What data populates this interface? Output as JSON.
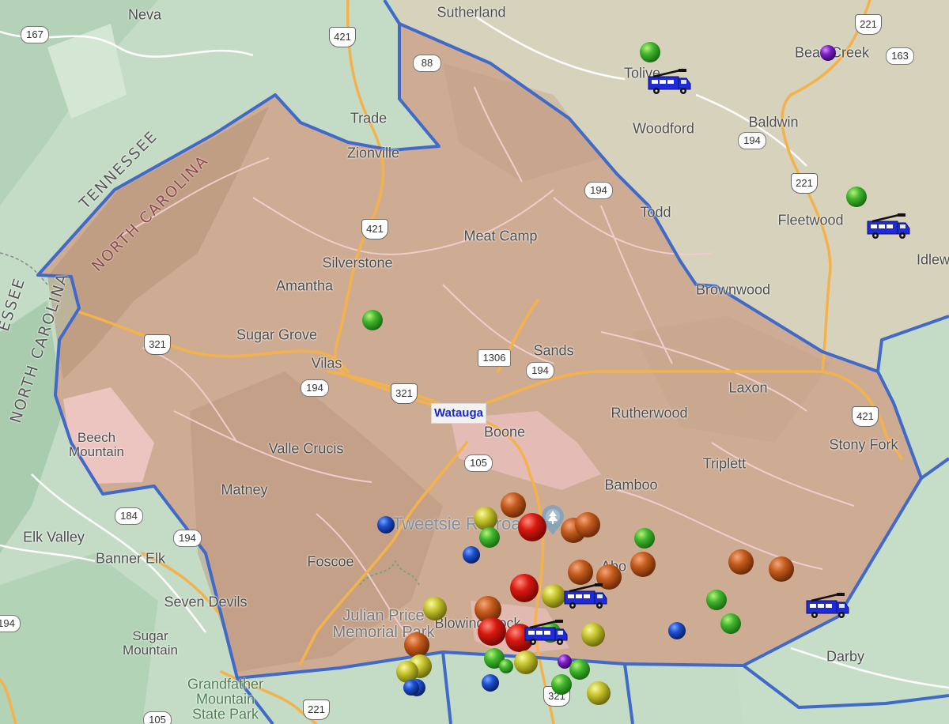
{
  "county": {
    "name": "Watauga"
  },
  "states": [
    {
      "name": "TENNESSEE",
      "variant": "tn"
    },
    {
      "name": "NORTH CAROLINA",
      "variant": "nc"
    },
    {
      "name": "ESSEE",
      "variant": "tn"
    },
    {
      "name": "NORTH CAROLINA",
      "variant": "plain"
    }
  ],
  "places": [
    {
      "name": "Neva"
    },
    {
      "name": "Sutherland"
    },
    {
      "name": "Trade"
    },
    {
      "name": "Zionville"
    },
    {
      "name": "Tolive"
    },
    {
      "name": "Beav Creek"
    },
    {
      "name": "Woodford"
    },
    {
      "name": "Baldwin"
    },
    {
      "name": "Todd"
    },
    {
      "name": "Fleetwood"
    },
    {
      "name": "Idlew"
    },
    {
      "name": "Meat Camp"
    },
    {
      "name": "Silverstone"
    },
    {
      "name": "Amantha"
    },
    {
      "name": "Brownwood"
    },
    {
      "name": "Sugar Grove"
    },
    {
      "name": "Sands"
    },
    {
      "name": "Vilas"
    },
    {
      "name": "Laxon"
    },
    {
      "name": "Rutherwood"
    },
    {
      "name": "Boone"
    },
    {
      "name": "Stony Fork"
    },
    {
      "name": "Beech\nMountain"
    },
    {
      "name": "Valle Crucis"
    },
    {
      "name": "Triplett"
    },
    {
      "name": "Matney"
    },
    {
      "name": "Bamboo"
    },
    {
      "name": "Elk Valley"
    },
    {
      "name": "Banner Elk"
    },
    {
      "name": "Foscoe"
    },
    {
      "name": "Abo"
    },
    {
      "name": "Seven Devils"
    },
    {
      "name": "Julian Price\nMemorial Park"
    },
    {
      "name": "Blowing Rock"
    },
    {
      "name": "Sugar\nMountain"
    },
    {
      "name": "Darby"
    },
    {
      "name": "Grandfather\nMountain\nState Park"
    }
  ],
  "poi": {
    "name": "Tweetsie Railroad"
  },
  "shields": [
    {
      "num": "167"
    },
    {
      "num": "421"
    },
    {
      "num": "88"
    },
    {
      "num": "221"
    },
    {
      "num": "163"
    },
    {
      "num": "194"
    },
    {
      "num": "221"
    },
    {
      "num": "194"
    },
    {
      "num": "421"
    },
    {
      "num": "321"
    },
    {
      "num": "1306"
    },
    {
      "num": "194"
    },
    {
      "num": "194"
    },
    {
      "num": "321"
    },
    {
      "num": "421"
    },
    {
      "num": "105"
    },
    {
      "num": "184"
    },
    {
      "num": "194"
    },
    {
      "num": "194"
    },
    {
      "num": "321"
    },
    {
      "num": "221"
    },
    {
      "num": "105"
    }
  ],
  "markers": [
    {
      "color": "green"
    },
    {
      "color": "purple"
    },
    {
      "color": "green"
    },
    {
      "color": "green"
    },
    {
      "color": "orange"
    },
    {
      "color": "yellow"
    },
    {
      "color": "blue"
    },
    {
      "color": "green"
    },
    {
      "color": "red"
    },
    {
      "color": "orange"
    },
    {
      "color": "orange"
    },
    {
      "color": "green"
    },
    {
      "color": "blue"
    },
    {
      "color": "orange"
    },
    {
      "color": "orange"
    },
    {
      "color": "orange"
    },
    {
      "color": "orange"
    },
    {
      "color": "orange"
    },
    {
      "color": "red"
    },
    {
      "color": "yellow"
    },
    {
      "color": "green"
    },
    {
      "color": "green"
    },
    {
      "color": "yellow"
    },
    {
      "color": "orange"
    },
    {
      "color": "red"
    },
    {
      "color": "red"
    },
    {
      "color": "green"
    },
    {
      "color": "yellow"
    },
    {
      "color": "blue"
    },
    {
      "color": "orange"
    },
    {
      "color": "yellow"
    },
    {
      "color": "yellow"
    },
    {
      "color": "green"
    },
    {
      "color": "yellow"
    },
    {
      "color": "purple"
    },
    {
      "color": "green"
    },
    {
      "color": "blue"
    },
    {
      "color": "green"
    },
    {
      "color": "blue"
    },
    {
      "color": "yellow"
    },
    {
      "color": "blue"
    },
    {
      "color": "green"
    }
  ],
  "trucks": [
    {},
    {},
    {},
    {},
    {}
  ],
  "colors": {
    "county_fill": "#cfa991",
    "county_border": "#4169c8",
    "town_area": "#f0c8c8",
    "land": "#c4dcc6",
    "land_east": "#d9d2bb",
    "highway": "#f3b24c"
  }
}
